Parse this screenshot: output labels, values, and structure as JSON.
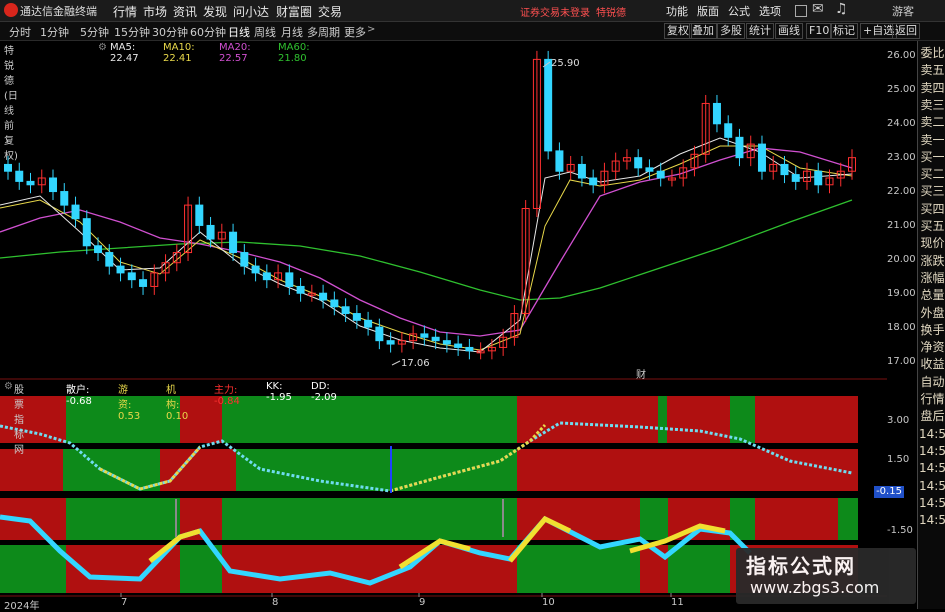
{
  "titlebar": {
    "app": "通达信金融终端",
    "menu": [
      "行情",
      "市场",
      "资讯",
      "发现",
      "问小达",
      "财富圈",
      "交易"
    ],
    "warning": "证券交易未登录",
    "stock": "特锐德",
    "right_menu": [
      "功能",
      "版面",
      "公式",
      "选项"
    ],
    "right_extra": "游客"
  },
  "toolbar": {
    "periods": [
      "分时",
      "1分钟",
      "5分钟",
      "15分钟",
      "30分钟",
      "60分钟",
      "日线",
      "周线",
      "月线",
      "多周期",
      "更多"
    ],
    "active": "日线",
    "right": [
      "复权",
      "叠加",
      "多股",
      "统计",
      "画线",
      "F10",
      "标记",
      "+自选",
      "返回"
    ]
  },
  "ma": {
    "title": "特锐德(日线 前复权)",
    "items": [
      {
        "label": "MA5: 22.47",
        "color": "#e8e8e8"
      },
      {
        "label": "MA10: 22.41",
        "color": "#e8d84a"
      },
      {
        "label": "MA20: 22.57",
        "color": "#d050d0"
      },
      {
        "label": "MA60: 21.80",
        "color": "#2fc02f"
      }
    ]
  },
  "price_axis": [
    "26.00",
    "25.00",
    "24.00",
    "23.00",
    "22.00",
    "21.00",
    "20.00",
    "19.00",
    "18.00",
    "17.00"
  ],
  "annotations": {
    "high": "25.90",
    "low": "17.06",
    "marker": "财"
  },
  "indicator": {
    "title": "股票指标网",
    "items": [
      {
        "label": "散户: -0.68",
        "color": "#ffffff"
      },
      {
        "label": "游资: 0.53",
        "color": "#e8d84a"
      },
      {
        "label": "机构: 0.10",
        "color": "#e8d84a"
      },
      {
        "label": "主力: -0.84",
        "color": "#ff3030"
      },
      {
        "label": "KK: -1.95",
        "color": "#ffffff"
      },
      {
        "label": "DD: -2.09",
        "color": "#ffffff"
      }
    ]
  },
  "ind_axis": [
    "3.00",
    "1.50",
    "-0.15",
    "-1.50"
  ],
  "right_panel": [
    "委比",
    "卖五",
    "卖四",
    "卖三",
    "卖二",
    "卖一",
    "买一",
    "买二",
    "买三",
    "买四",
    "买五",
    "现价",
    "涨跌",
    "涨幅",
    "总量",
    "外盘",
    "换手",
    "净资",
    "收益",
    "自动",
    "行情",
    "盘后",
    "14:5",
    "14:5",
    "14:5",
    "14:5",
    "14:5",
    "14:5"
  ],
  "x_axis": [
    "2024年",
    "7",
    "8",
    "9",
    "10",
    "11"
  ],
  "watermark": {
    "line1": "指标公式网",
    "line2": "www.zbgs3.com"
  },
  "colors": {
    "up": "#ff3030",
    "down": "#33d6ff",
    "ma5": "#e8e8e8",
    "ma10": "#e8d84a",
    "ma20": "#d050d0",
    "ma60": "#2fc02f",
    "band_red": "#b01010",
    "band_green": "#0d8a1a"
  }
}
